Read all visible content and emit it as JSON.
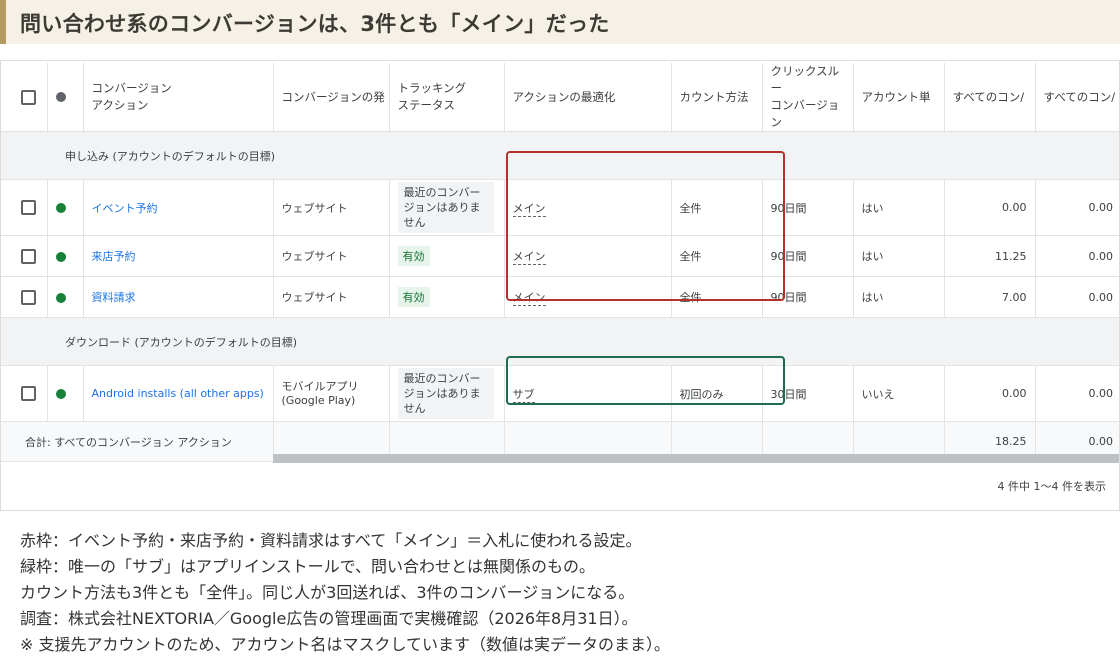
{
  "heading": "問い合わせ系のコンバージョンは、3件とも「メイン」だった",
  "columns": {
    "action": "コンバージョン\nアクション",
    "source": "コンバージョンの発",
    "tracking": "トラッキング\nステータス",
    "optimization": "アクションの最適化",
    "count": "カウント方法",
    "window": "クリックスルー\nコンバージョン",
    "account": "アカウント単",
    "all_conv": "すべてのコン/",
    "all_conv2": "すべてのコン/"
  },
  "groups": [
    {
      "label": "申し込み (アカウントのデフォルトの目標)"
    },
    {
      "label": "ダウンロード (アカウントのデフォルトの目標)"
    }
  ],
  "rows": [
    {
      "name": "イベント予約",
      "source": "ウェブサイト",
      "tracking": "最近のコンバージョンはありません",
      "optimization": "メイン",
      "count": "全件",
      "window_num": "90",
      "window_unit": "日間",
      "account": "はい",
      "all_conv": "0.00",
      "all_conv2": "0.00"
    },
    {
      "name": "来店予約",
      "source": "ウェブサイト",
      "tracking": "有効",
      "optimization": "メイン",
      "count": "全件",
      "window_num": "90",
      "window_unit": "日間",
      "account": "はい",
      "all_conv": "11.25",
      "all_conv2": "0.00"
    },
    {
      "name": "資料請求",
      "source": "ウェブサイト",
      "tracking": "有効",
      "optimization": "メイン",
      "count": "全件",
      "window_num": "90",
      "window_unit": "日間",
      "account": "はい",
      "all_conv": "7.00",
      "all_conv2": "0.00"
    },
    {
      "name": "Android installs (all other apps)",
      "source": "モバイルアプリ (Google Play)",
      "tracking": "最近のコンバージョンはありません",
      "optimization": "サブ",
      "count": "初回のみ",
      "window_num": "30",
      "window_unit": "日間",
      "account": "いいえ",
      "all_conv": "0.00",
      "all_conv2": "0.00"
    }
  ],
  "total": {
    "label": "合計: すべてのコンバージョン アクション",
    "all_conv": "18.25",
    "all_conv2": "0.00"
  },
  "pager": "4 件中 1～4 件を表示",
  "notes": [
    "赤枠：イベント予約・来店予約・資料請求はすべて「メイン」＝入札に使われる設定。",
    "緑枠：唯一の「サブ」はアプリインストールで、問い合わせとは無関係のもの。",
    "カウント方法も3件とも「全件」。同じ人が3回送れば、3件のコンバージョンになる。",
    "調査：株式会社NEXTORIA／Google広告の管理画面で実機確認（2026年8月31日）。",
    "※ 支援先アカウントのため、アカウント名はマスクしています（数値は実データのまま）。"
  ],
  "colors": {
    "main_box": "#b3312b",
    "sub_box": "#1e6b4e",
    "link": "#1a73e8",
    "active_dot": "#188038"
  }
}
